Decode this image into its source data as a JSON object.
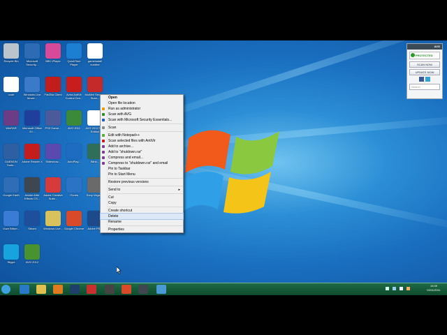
{
  "desktop_icons": [
    {
      "label": "Recycle Bin",
      "color": "#b9c4cc"
    },
    {
      "label": "Microsoft Security...",
      "color": "#2d6bb5"
    },
    {
      "label": "BBC iPlayer",
      "color": "#d64a98"
    },
    {
      "label": "QuickTime Player",
      "color": "#1d7fd1"
    },
    {
      "label": "gameinstall number",
      "color": "#ffffff"
    },
    {
      "label": "code",
      "color": "#ffffff"
    },
    {
      "label": "Windows Live Movie...",
      "color": "#3a7ac9"
    },
    {
      "label": "FileZilla Client",
      "color": "#c21d1d"
    },
    {
      "label": "Avira AntiVir Control Cen...",
      "color": "#c91d1d"
    },
    {
      "label": "McAfee Security Scan...",
      "color": "#c42a2a"
    },
    {
      "label": "WinRAR",
      "color": "#6b3d86"
    },
    {
      "label": "Microsoft Office 20...",
      "color": "#1f3f9c"
    },
    {
      "label": "PS3 Game...",
      "color": "#4b5a9a"
    },
    {
      "label": "AVG 2011",
      "color": "#3a8a3a"
    },
    {
      "label": "AVG 2011 Free Edition",
      "color": "#ffffff"
    },
    {
      "label": "DAEMON Tools...",
      "color": "#2e5fa3"
    },
    {
      "label": "Adobe Reader X",
      "color": "#c51d1d"
    },
    {
      "label": "Slideshow...",
      "color": "#5a4ab0"
    },
    {
      "label": "AutoPlay...",
      "color": "#1e6cc2"
    },
    {
      "label": "Blink...",
      "color": "#2f6f5a"
    },
    {
      "label": "Google Earth",
      "color": "#2f6db6"
    },
    {
      "label": "Adobe After Effects CS...",
      "color": "#3e4650"
    },
    {
      "label": "Adobe Creative Suite...",
      "color": "#d63a3a"
    },
    {
      "label": "iTunes",
      "color": "#2a73c5"
    },
    {
      "label": "Sony Vegas...",
      "color": "#6a6a6a"
    },
    {
      "label": "Vuze Bittorr...",
      "color": "#3a7bd5"
    },
    {
      "label": "Steam",
      "color": "#1d4f9c"
    },
    {
      "label": "Windows Live...",
      "color": "#d9c25c"
    },
    {
      "label": "Google Chrome",
      "color": "#d84a2a"
    },
    {
      "label": "Adobe PS...",
      "color": "#1d4a8a"
    },
    {
      "label": "Skype",
      "color": "#17a3de"
    },
    {
      "label": "AVG 2012",
      "color": "#48922f"
    }
  ],
  "context_menu": {
    "items": [
      {
        "label": "Open",
        "bold": true
      },
      {
        "label": "Open file location"
      },
      {
        "label": "Run as administrator",
        "icon": "shield-icon",
        "icolor": "#e0a000"
      },
      {
        "label": "Scan with AVG",
        "icon": "avg-icon",
        "icolor": "#2c8a2c"
      },
      {
        "label": "Scan with Microsoft Security Essentials...",
        "icon": "mse-icon",
        "icolor": "#1f5fb0"
      },
      {
        "sep": true
      },
      {
        "label": "Scan",
        "icon": "scan-icon",
        "icolor": "#888888"
      },
      {
        "sep": true
      },
      {
        "label": "Edit with Notepad++",
        "icon": "notepad-icon",
        "icolor": "#5aa83a"
      },
      {
        "label": "Scan selected files with AntiVir",
        "icon": "antivir-icon",
        "icolor": "#c21d1d"
      },
      {
        "label": "Add to archive...",
        "icon": "rar-icon",
        "icolor": "#7b3d8c"
      },
      {
        "label": "Add to \"shutdown.rar\"",
        "icon": "rar-icon",
        "icolor": "#7b3d8c"
      },
      {
        "label": "Compress and email...",
        "icon": "rar-icon",
        "icolor": "#7b3d8c"
      },
      {
        "label": "Compress to \"shutdown.rar\" and email",
        "icon": "rar-icon",
        "icolor": "#7b3d8c"
      },
      {
        "label": "Pin to Taskbar"
      },
      {
        "label": "Pin to Start Menu"
      },
      {
        "sep": true
      },
      {
        "label": "Restore previous versions"
      },
      {
        "sep": true
      },
      {
        "label": "Send to",
        "submenu": true
      },
      {
        "sep": true
      },
      {
        "label": "Cut"
      },
      {
        "label": "Copy"
      },
      {
        "sep": true
      },
      {
        "label": "Create shortcut"
      },
      {
        "label": "Delete",
        "highlighted": true
      },
      {
        "label": "Rename"
      },
      {
        "sep": true
      },
      {
        "label": "Properties"
      }
    ]
  },
  "avg_widget": {
    "title": "AVG",
    "status": "PROTECTED",
    "scan_label": "SCAN NOW",
    "update_label": "UPDATE NOW",
    "search_placeholder": "Search"
  },
  "taskbar": {
    "time": "19:39",
    "date": "03/11/2011",
    "buttons": [
      {
        "name": "start-button",
        "color": "#3fa0e0"
      },
      {
        "name": "ie-icon",
        "color": "#2a78c8"
      },
      {
        "name": "explorer-icon",
        "color": "#e0c050"
      },
      {
        "name": "media-player-icon",
        "color": "#e07b20"
      },
      {
        "name": "steam-icon",
        "color": "#1d3f6a"
      },
      {
        "name": "tool-icon",
        "color": "#c83030"
      },
      {
        "name": "settings-icon",
        "color": "#444"
      },
      {
        "name": "chrome-icon",
        "color": "#d84a2a"
      },
      {
        "name": "ae-icon",
        "color": "#3e4650"
      },
      {
        "name": "network-icon",
        "color": "#4a9ad6"
      }
    ]
  }
}
